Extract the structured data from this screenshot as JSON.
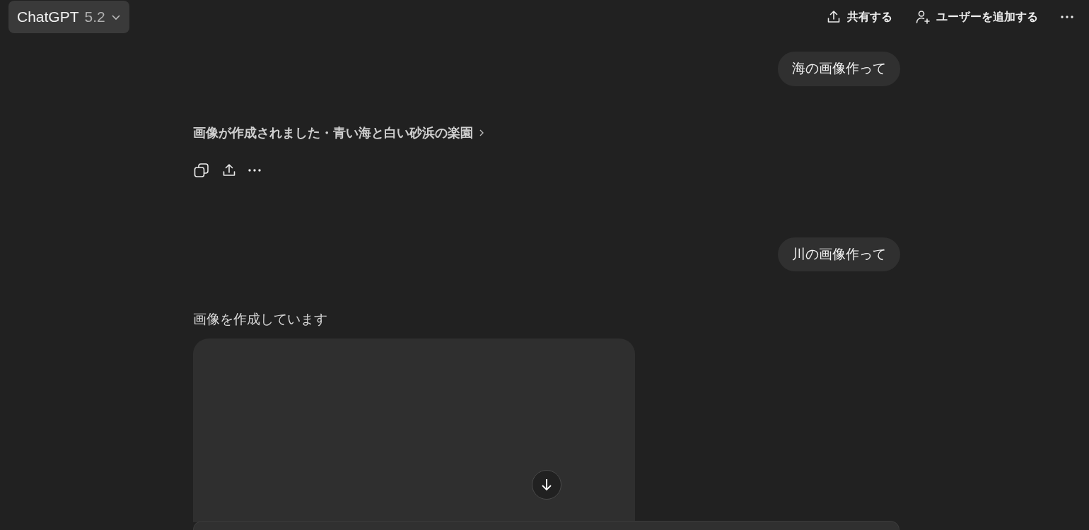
{
  "header": {
    "model_name": "ChatGPT",
    "model_version": "5.2",
    "actions": [
      {
        "kind": "share",
        "label": "共有する"
      },
      {
        "kind": "add_user",
        "label": "ユーザーを追加する"
      },
      {
        "kind": "more"
      }
    ]
  },
  "messages": [
    {
      "kind": "user",
      "text": "海の画像作って"
    },
    {
      "kind": "image_done",
      "title": "画像が作成されました・青い海と白い砂浜の楽園"
    },
    {
      "kind": "user",
      "text": "川の画像作って"
    },
    {
      "kind": "image_pending",
      "title": "画像を作成しています"
    }
  ]
}
